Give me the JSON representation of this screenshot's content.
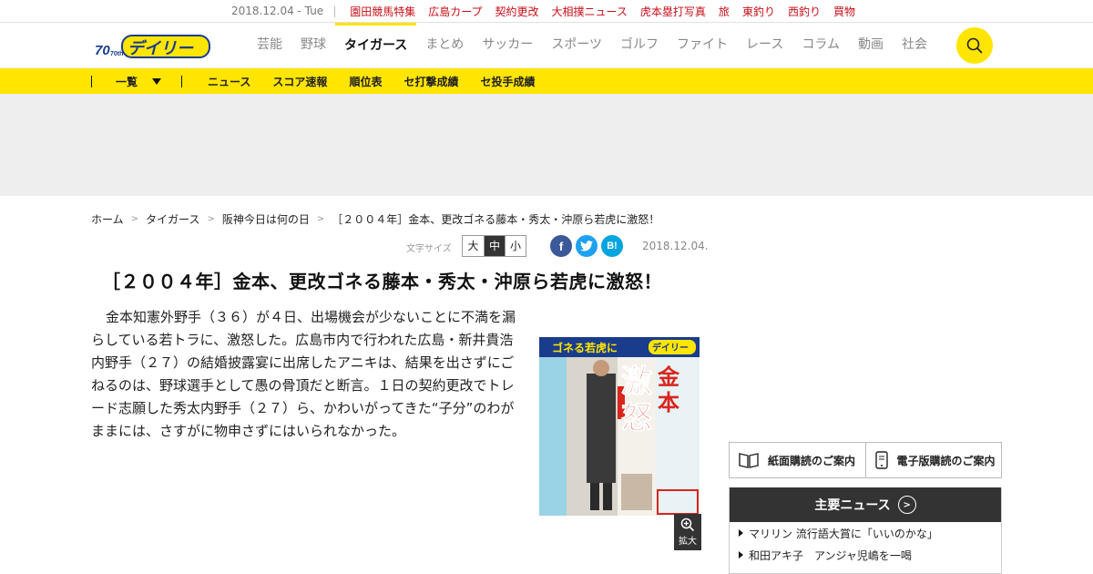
{
  "topbar": {
    "date": "2018.12.04 - Tue",
    "links": [
      "園田競馬特集",
      "広島カープ",
      "契約更改",
      "大相撲ニュース",
      "虎本塁打写真",
      "旅",
      "東釣り",
      "西釣り",
      "買物"
    ]
  },
  "header": {
    "logo_text": "デイリー",
    "logo_anniv": "70th",
    "nav": [
      "芸能",
      "野球",
      "タイガース",
      "まとめ",
      "サッカー",
      "スポーツ",
      "ゴルフ",
      "ファイト",
      "レース",
      "コラム",
      "動画",
      "社会"
    ],
    "active_nav": "タイガース"
  },
  "subnav": {
    "menu_label": "一覧",
    "links": [
      "ニュース",
      "スコア速報",
      "順位表",
      "セ打撃成績",
      "セ投手成績"
    ]
  },
  "breadcrumb": [
    "ホーム",
    "タイガース",
    "阪神今日は何の日",
    "［２００４年］金本、更改ゴネる藤本・秀太・沖原ら若虎に激怒！"
  ],
  "tools": {
    "fontsize_label": "文字サイズ",
    "sizes": [
      "大",
      "中",
      "小"
    ],
    "selected_size": "中",
    "share": {
      "facebook": "f",
      "twitter": "t",
      "hatena": "B!"
    },
    "date": "2018.12.04."
  },
  "article": {
    "headline": "［２００４年］金本、更改ゴネる藤本・秀太・沖原ら若虎に激怒！",
    "body": "金本知憲外野手（３６）が４日、出場機会が少ないことに不満を漏らしている若トラに、激怒した。広島市内で行われた広島・新井貴浩内野手（２７）の結婚披露宴に出席したアニキは、結果を出さずにごねるのは、野球選手として愚の骨頂だと断言。１日の契約更改でトレード志願した秀太内野手（２７）ら、かわいがってきた“子分”のわがままには、さすがに物申さずにはいられなかった。",
    "photo_texts": {
      "banner": "ゴネる若虎に",
      "logo": "デイリー",
      "big1": "激",
      "big2": "怒",
      "name": "金本"
    },
    "zoom_label": "拡大"
  },
  "sidebar": {
    "subscribe_paper": "紙面購読のご案内",
    "subscribe_digital": "電子版購読のご案内",
    "news_title": "主要ニュース",
    "news": [
      "マリリン 流行語大賞に「いいのかな」",
      "和田アキ子　アンジャ児嶋を一喝"
    ]
  },
  "colors": {
    "accent_yellow": "#ffe500",
    "top_link_red": "#c8101a",
    "dark": "#333333"
  }
}
